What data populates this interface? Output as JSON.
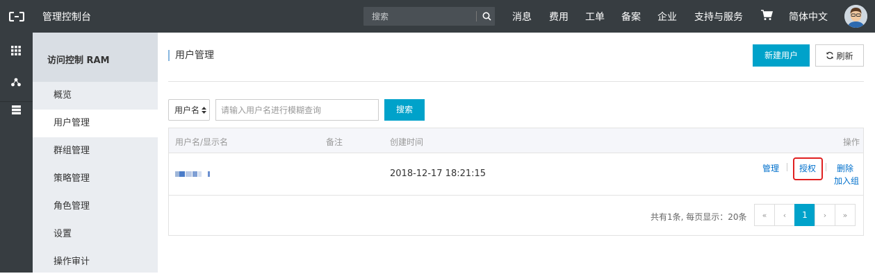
{
  "topbar": {
    "title": "管理控制台",
    "search_placeholder": "搜索",
    "nav": [
      "消息",
      "费用",
      "工单",
      "备案",
      "企业",
      "支持与服务"
    ],
    "language": "简体中文",
    "icons": {
      "logo": "aliyun-logo-icon",
      "search": "search-icon",
      "cart": "cart-icon"
    }
  },
  "rail": {
    "icons": [
      "grid-icon",
      "cluster-icon",
      "server-icon"
    ]
  },
  "sidebar": {
    "header": "访问控制 RAM",
    "items": [
      {
        "label": "概览",
        "active": false
      },
      {
        "label": "用户管理",
        "active": true
      },
      {
        "label": "群组管理",
        "active": false
      },
      {
        "label": "策略管理",
        "active": false
      },
      {
        "label": "角色管理",
        "active": false
      },
      {
        "label": "设置",
        "active": false
      },
      {
        "label": "操作审计",
        "active": false
      }
    ]
  },
  "main": {
    "page_title": "用户管理",
    "new_user_label": "新建用户",
    "refresh_label": "刷新",
    "filter": {
      "select_value": "用户名",
      "input_placeholder": "请输入用户名进行模糊查询",
      "search_label": "搜索"
    },
    "table": {
      "columns": [
        "用户名/显示名",
        "备注",
        "创建时间",
        "操作"
      ],
      "rows": [
        {
          "username": "",
          "note": "",
          "created": "2018-12-17 18:21:15",
          "actions": [
            "管理",
            "授权",
            "删除",
            "加入组"
          ]
        }
      ]
    },
    "pagination": {
      "summary": "共有1条, 每页显示：20条",
      "first": "«",
      "prev": "‹",
      "current": "1",
      "next": "›",
      "last": "»"
    }
  },
  "colors": {
    "topbar": "#373d41",
    "primary": "#00a2ca",
    "link": "#0070cc",
    "highlight": "#e02020",
    "sidebar": "#eaedf1"
  }
}
